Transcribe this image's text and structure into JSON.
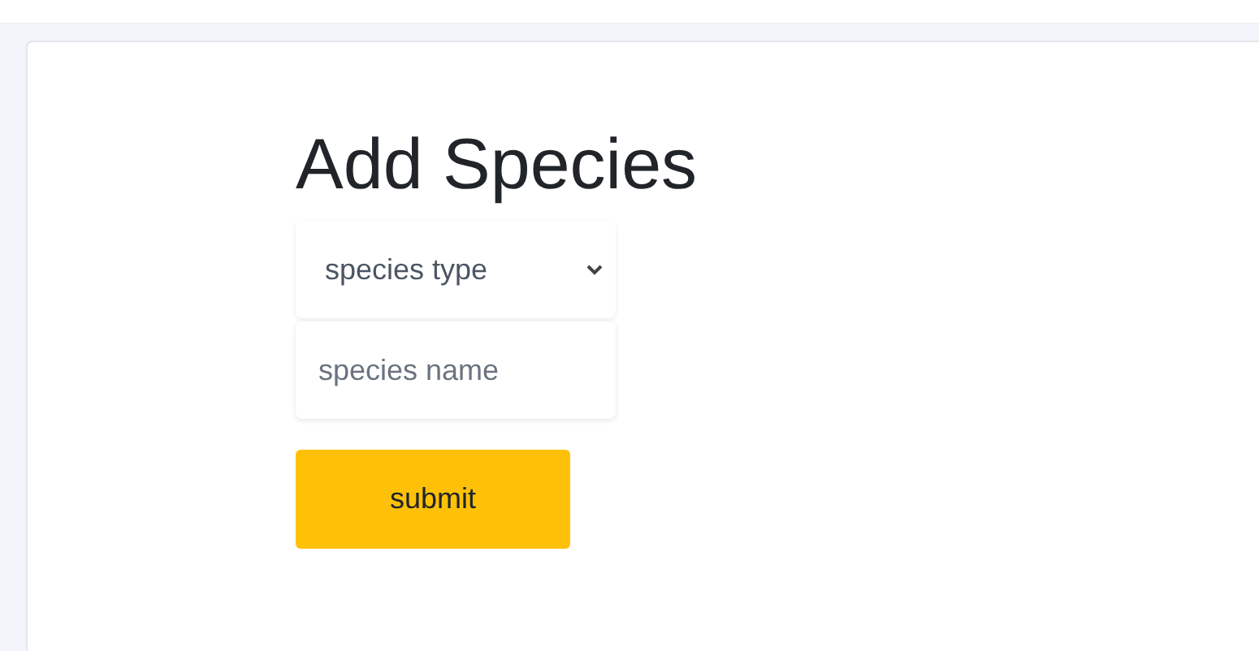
{
  "form": {
    "title": "Add Species",
    "species_type_select": {
      "value": "species type"
    },
    "species_name_field": {
      "placeholder": "species name"
    },
    "submit_button": {
      "label": "submit"
    }
  }
}
